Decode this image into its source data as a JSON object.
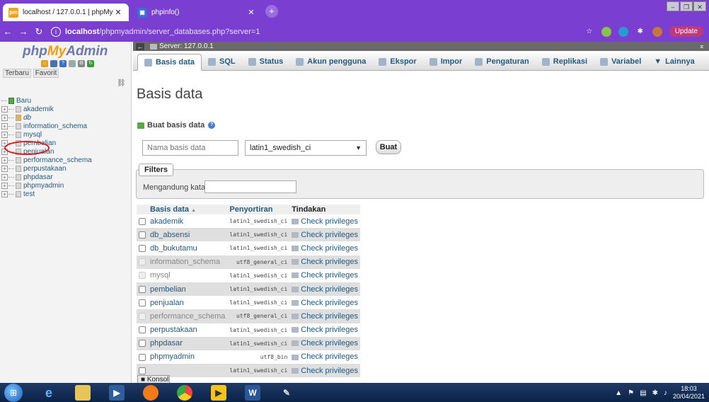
{
  "browser": {
    "tabs": [
      {
        "title": "localhost / 127.0.0.1 | phpMyAdm",
        "favicon": "phpmyadmin-icon"
      },
      {
        "title": "phpinfo()",
        "favicon": "php-icon"
      }
    ],
    "new_tab": "+",
    "url_host": "localhost",
    "url_path": "/phpmyadmin/server_databases.php?server=1",
    "update_label": "Update",
    "accent": "#7a3fd1"
  },
  "nav": {
    "logo_php": "php",
    "logo_my": "My",
    "logo_admin": "Admin",
    "recent": "Terbaru",
    "favorites": "Favorit",
    "new_label": "Baru",
    "databases": [
      "akademik",
      "db",
      "information_schema",
      "mysql",
      "pembelian",
      "penjualan",
      "performance_schema",
      "perpustakaan",
      "phpdasar",
      "phpmyadmin",
      "test"
    ]
  },
  "server": {
    "label": "Server: 127.0.0.1"
  },
  "menu": {
    "tabs": [
      "Basis data",
      "SQL",
      "Status",
      "Akun pengguna",
      "Ekspor",
      "Impor",
      "Pengaturan",
      "Replikasi",
      "Variabel",
      "Lainnya"
    ]
  },
  "main": {
    "title": "Basis data",
    "create_heading": "Buat basis data",
    "dbname_placeholder": "Nama basis data",
    "collation_value": "latin1_swedish_ci",
    "create_button": "Buat",
    "filters_legend": "Filters",
    "filter_label": "Mengandung kata:"
  },
  "table": {
    "headers": [
      "Basis data",
      "Penyortiran",
      "Tindakan"
    ],
    "sort_indicator": "▲",
    "action_label": "Check privileges",
    "rows": [
      {
        "name": "akademik",
        "collation": "latin1_swedish_ci"
      },
      {
        "name": "db_absensi",
        "collation": "latin1_swedish_ci"
      },
      {
        "name": "db_bukutamu",
        "collation": "latin1_swedish_ci"
      },
      {
        "name": "information_schema",
        "collation": "utf8_general_ci"
      },
      {
        "name": "mysql",
        "collation": "latin1_swedish_ci"
      },
      {
        "name": "pembelian",
        "collation": "latin1_swedish_ci"
      },
      {
        "name": "penjualan",
        "collation": "latin1_swedish_ci"
      },
      {
        "name": "performance_schema",
        "collation": "utf8_general_ci"
      },
      {
        "name": "perpustakaan",
        "collation": "latin1_swedish_ci"
      },
      {
        "name": "phpdasar",
        "collation": "latin1_swedish_ci"
      },
      {
        "name": "phpmyadmin",
        "collation": "utf8_bin"
      },
      {
        "name": "",
        "collation": "latin1_swedish_ci"
      }
    ]
  },
  "console": {
    "label": "Konsol"
  },
  "taskbar": {
    "time": "18:03",
    "date": "20/04/2021",
    "apps": [
      "windows-start-icon",
      "ie-icon",
      "file-explorer-icon",
      "media-icon",
      "firefox-icon",
      "chrome-icon",
      "player-icon",
      "word-icon",
      "app-icon"
    ]
  }
}
